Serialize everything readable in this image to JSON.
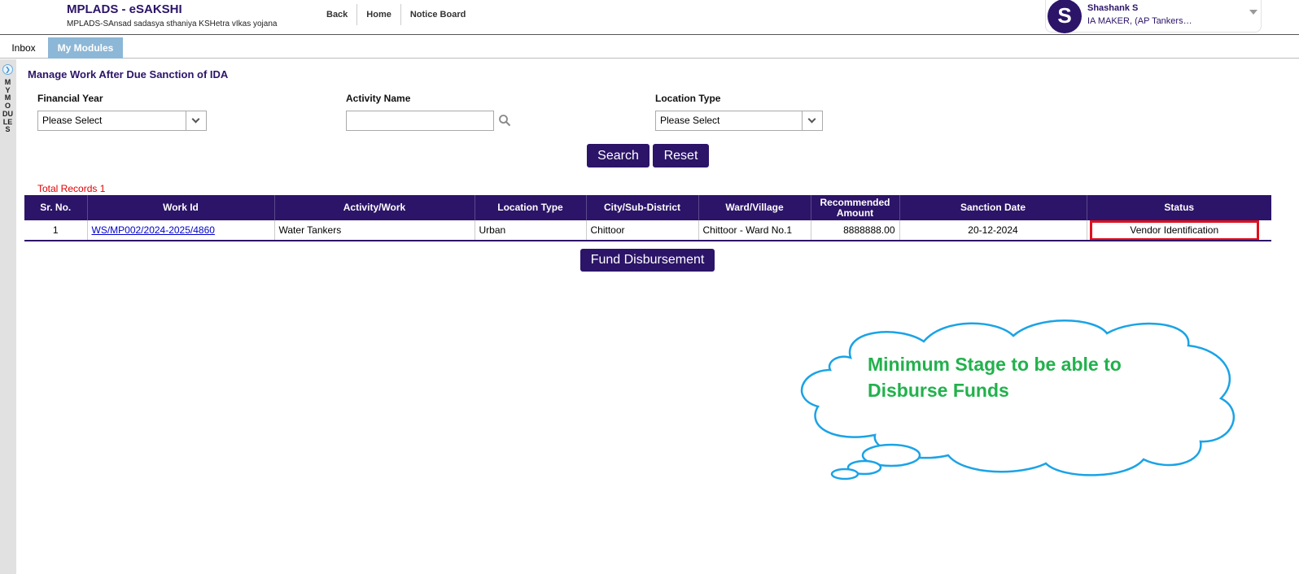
{
  "app": {
    "title": "MPLADS - eSAKSHI",
    "subtitle": "MPLADS-SAnsad sadasya sthaniya KSHetra vIkas yojana"
  },
  "topnav": {
    "back": "Back",
    "home": "Home",
    "notice_board": "Notice Board"
  },
  "user": {
    "initial": "S",
    "name": "Shashank S",
    "role": "IA MAKER, (AP Tankers…"
  },
  "tabs": {
    "inbox": "Inbox",
    "my_modules": "My Modules"
  },
  "left_rail": {
    "label": "MY MODULES"
  },
  "page": {
    "title": "Manage Work After Due Sanction of IDA"
  },
  "filters": {
    "financial_year": {
      "label": "Financial Year",
      "value": "Please Select"
    },
    "activity_name": {
      "label": "Activity Name",
      "value": ""
    },
    "location_type": {
      "label": "Location Type",
      "value": "Please Select"
    }
  },
  "buttons": {
    "search": "Search",
    "reset": "Reset",
    "fund_disbursement": "Fund Disbursement"
  },
  "results": {
    "total_records": "Total Records 1",
    "columns": [
      "Sr. No.",
      "Work Id",
      "Activity/Work",
      "Location Type",
      "City/Sub-District",
      "Ward/Village",
      "Recommended Amount",
      "Sanction Date",
      "Status"
    ],
    "rows": [
      {
        "sr_no": "1",
        "work_id": "WS/MP002/2024-2025/4860",
        "activity": "Water Tankers",
        "location_type": "Urban",
        "city": "Chittoor",
        "ward": "Chittoor - Ward No.1",
        "amount": "8888888.00",
        "sanction_date": "20-12-2024",
        "status": "Vendor Identification"
      }
    ]
  },
  "callout": {
    "text": "Minimum Stage to be able to Disburse Funds",
    "line1": "Minimum Stage to be able to",
    "line2": "Disburse Funds",
    "text_color": "#22b14c",
    "outline_color": "#1aa3e6"
  },
  "colors": {
    "brand": "#2c1468",
    "tab_active": "#8db7d6",
    "highlight_border": "#e0101c",
    "records_text": "#e00000"
  }
}
